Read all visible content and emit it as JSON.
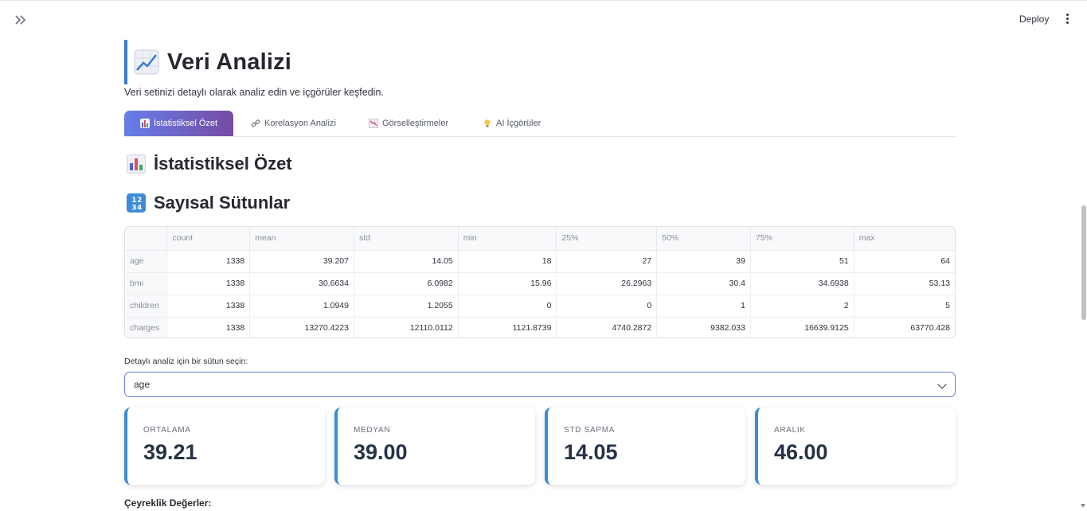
{
  "app": {
    "deploy_label": "Deploy",
    "icons": {
      "sidebar": "double-chevron-right-icon",
      "menu": "vertical-dots-icon"
    }
  },
  "page": {
    "title": "Veri Analizi",
    "title_icon": "chart-increasing-icon",
    "subtitle": "Veri setinizi detaylı olarak analiz edin ve içgörüler keşfedin."
  },
  "tabs": [
    {
      "label": "İstatistiksel Özet",
      "icon": "bar-chart-icon",
      "active": true
    },
    {
      "label": "Korelasyon Analizi",
      "icon": "link-icon",
      "active": false
    },
    {
      "label": "Görselleştirmeler",
      "icon": "chart-decreasing-icon",
      "active": false
    },
    {
      "label": "AI İçgörüler",
      "icon": "light-bulb-icon",
      "active": false
    }
  ],
  "sections": {
    "summary_title": "İstatistiksel Özet",
    "summary_icon": "bar-chart-icon",
    "numeric_title": "Sayısal Sütunlar",
    "numeric_icon": "input-numbers-icon"
  },
  "stats_table": {
    "columns": [
      "",
      "count",
      "mean",
      "std",
      "min",
      "25%",
      "50%",
      "75%",
      "max"
    ],
    "rows": [
      [
        "age",
        "1338",
        "39.207",
        "14.05",
        "18",
        "27",
        "39",
        "51",
        "64"
      ],
      [
        "bmi",
        "1338",
        "30.6634",
        "6.0982",
        "15.96",
        "26.2963",
        "30.4",
        "34.6938",
        "53.13"
      ],
      [
        "children",
        "1338",
        "1.0949",
        "1.2055",
        "0",
        "0",
        "1",
        "2",
        "5"
      ],
      [
        "charges",
        "1338",
        "13270.4223",
        "12110.0112",
        "1121.8739",
        "4740.2872",
        "9382.033",
        "16639.9125",
        "63770.428"
      ]
    ]
  },
  "column_select": {
    "label": "Detaylı analiz için bir sütun seçin:",
    "value": "age"
  },
  "metrics": [
    {
      "label": "ORTALAMA",
      "value": "39.21"
    },
    {
      "label": "MEDYAN",
      "value": "39.00"
    },
    {
      "label": "STD SAPMA",
      "value": "14.05"
    },
    {
      "label": "ARALIK",
      "value": "46.00"
    }
  ],
  "quartile_label": "Çeyreklik Değerler:",
  "colors": {
    "accent": "#3a8ed5",
    "tab_gradient_start": "#667eea",
    "tab_gradient_end": "#764ba2",
    "title_border": "#3a7bd5"
  }
}
